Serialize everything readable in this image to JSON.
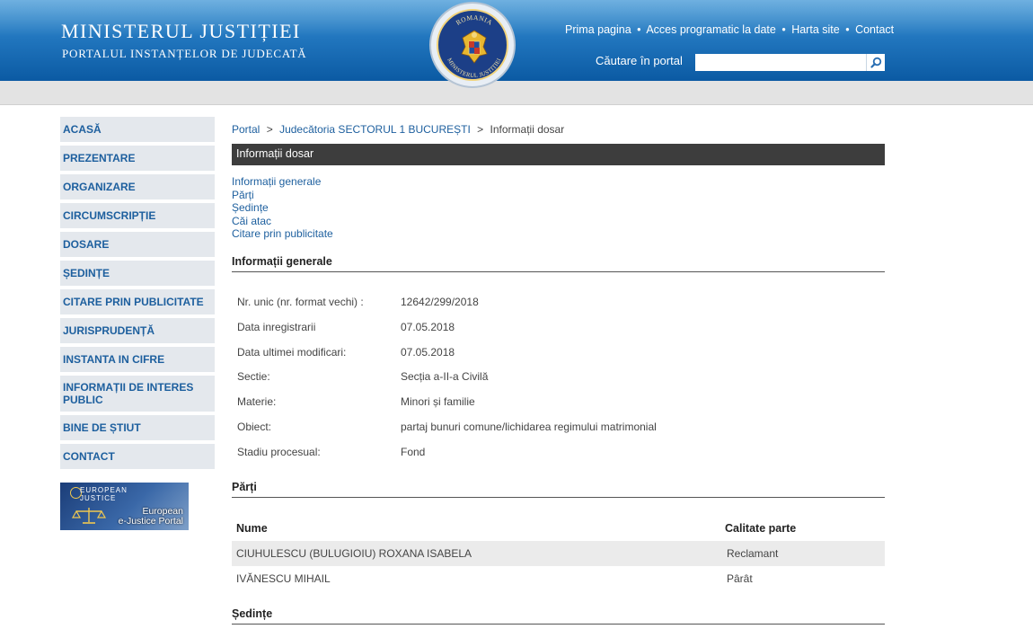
{
  "header": {
    "title": "MINISTERUL JUSTIȚIEI",
    "subtitle": "PORTALUL INSTANȚELOR DE JUDECATĂ",
    "seal": {
      "top_text": "ROMANIA",
      "bottom_text": "MINISTERUL JUSTIȚIEI"
    },
    "nav": [
      "Prima pagina",
      "Acces programatic la date",
      "Harta site",
      "Contact"
    ],
    "nav_separator": "•",
    "search_label": "Căutare în portal",
    "search_value": "",
    "search_icon": "magnifier-icon"
  },
  "sidebar": {
    "items": [
      "ACASĂ",
      "PREZENTARE",
      "ORGANIZARE",
      "CIRCUMSCRIPȚIE",
      "DOSARE",
      "ȘEDINȚE",
      "CITARE PRIN PUBLICITATE",
      "JURISPRUDENȚĂ",
      "INSTANTA IN CIFRE",
      "INFORMAȚII DE INTERES PUBLIC",
      "BINE DE ȘTIUT",
      "CONTACT"
    ],
    "ejustice": {
      "mark_line1": "EUROPEAN",
      "mark_line2": "JUSTICE",
      "text_line1": "European",
      "text_line2": "e-Justice Portal"
    }
  },
  "breadcrumb": {
    "items": [
      "Portal",
      "Judecătoria SECTORUL 1 BUCUREȘTI",
      "Informații dosar"
    ],
    "separator": ">"
  },
  "page_title": "Informații dosar",
  "section_links": [
    "Informații generale",
    "Părți",
    "Ședințe",
    "Căi atac",
    "Citare prin publicitate"
  ],
  "info": {
    "title": "Informații generale",
    "rows": [
      {
        "label": "Nr. unic (nr. format vechi) :",
        "value": "12642/299/2018"
      },
      {
        "label": "Data inregistrarii",
        "value": "07.05.2018"
      },
      {
        "label": "Data ultimei modificari:",
        "value": "07.05.2018"
      },
      {
        "label": "Sectie:",
        "value": "Secția a-II-a Civilă"
      },
      {
        "label": "Materie:",
        "value": "Minori și familie"
      },
      {
        "label": "Obiect:",
        "value": "partaj bunuri comune/lichidarea regimului matrimonial"
      },
      {
        "label": "Stadiu procesual:",
        "value": "Fond"
      }
    ]
  },
  "parti": {
    "title": "Părți",
    "headers": [
      "Nume",
      "Calitate parte"
    ],
    "rows": [
      [
        "CIUHULESCU (BULUGIOIU) ROXANA ISABELA",
        "Reclamant"
      ],
      [
        "IVĂNESCU MIHAIL",
        "Pârât"
      ]
    ]
  },
  "sedinte": {
    "title": "Ședințe"
  }
}
